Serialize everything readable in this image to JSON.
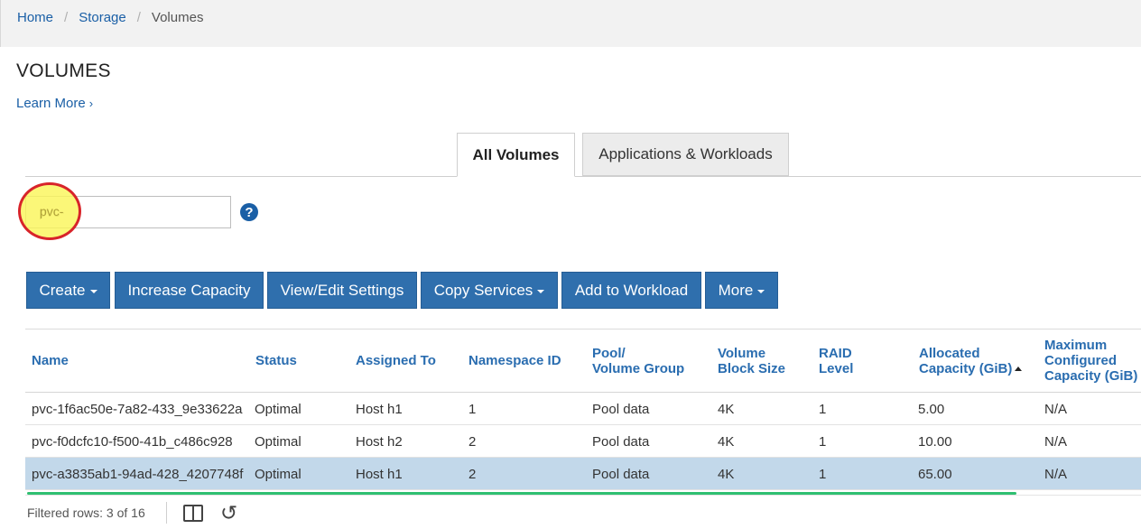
{
  "breadcrumb": {
    "home": "Home",
    "storage": "Storage",
    "current": "Volumes",
    "separator": "/"
  },
  "page": {
    "title": "VOLUMES",
    "learn_more": "Learn More",
    "learn_more_chevron": "›"
  },
  "tabs": [
    {
      "label": "All Volumes",
      "active": true
    },
    {
      "label": "Applications & Workloads",
      "active": false
    }
  ],
  "filter": {
    "value": "pvc-",
    "help_symbol": "?"
  },
  "toolbar": {
    "create": "Create",
    "increase_capacity": "Increase Capacity",
    "view_edit_settings": "View/Edit Settings",
    "copy_services": "Copy Services",
    "add_to_workload": "Add to Workload",
    "more": "More"
  },
  "table": {
    "columns": {
      "name": "Name",
      "status": "Status",
      "assigned_to": "Assigned To",
      "namespace_id": "Namespace ID",
      "pool_l1": "Pool/",
      "pool_l2": "Volume Group",
      "block_l1": "Volume",
      "block_l2": "Block Size",
      "raid_l1": "RAID",
      "raid_l2": "Level",
      "alloc_l1": "Allocated",
      "alloc_l2": "Capacity (GiB)",
      "max_l1": "Maximum",
      "max_l2": "Configured",
      "max_l3": "Capacity (GiB)"
    },
    "rows": [
      {
        "name": "pvc-1f6ac50e-7a82-433_9e33622a",
        "status": "Optimal",
        "assigned_to": "Host h1",
        "namespace_id": "1",
        "pool": "Pool data",
        "block_size": "4K",
        "raid": "1",
        "allocated": "5.00",
        "max_capacity": "N/A",
        "selected": false
      },
      {
        "name": "pvc-f0dcfc10-f500-41b_c486c928",
        "status": "Optimal",
        "assigned_to": "Host h2",
        "namespace_id": "2",
        "pool": "Pool data",
        "block_size": "4K",
        "raid": "1",
        "allocated": "10.00",
        "max_capacity": "N/A",
        "selected": false
      },
      {
        "name": "pvc-a3835ab1-94ad-428_4207748f",
        "status": "Optimal",
        "assigned_to": "Host h1",
        "namespace_id": "2",
        "pool": "Pool data",
        "block_size": "4K",
        "raid": "1",
        "allocated": "65.00",
        "max_capacity": "N/A",
        "selected": true
      }
    ]
  },
  "footer": {
    "filtered_rows": "Filtered rows: 3 of 16"
  },
  "icons": {
    "help": "help-circle-icon",
    "columns": "columns-icon",
    "refresh": "refresh-icon",
    "sort": "sort-ascending-icon"
  },
  "colors": {
    "link": "#1a5fa6",
    "button": "#2f6fad",
    "selected_row": "#c2d8ea",
    "highlight": "#faf55a",
    "highlight_border": "#d8242a",
    "progress": "#2fbf71"
  }
}
